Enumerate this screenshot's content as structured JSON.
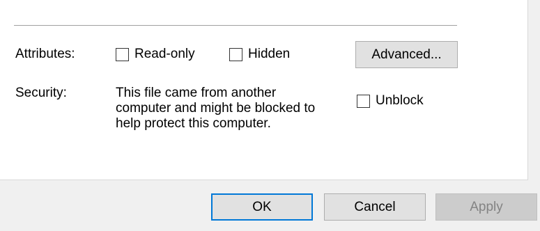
{
  "attributes": {
    "label": "Attributes:",
    "read_only": {
      "label": "Read-only",
      "checked": false
    },
    "hidden": {
      "label": "Hidden",
      "checked": false
    },
    "advanced_button": "Advanced..."
  },
  "security": {
    "label": "Security:",
    "message_lines": [
      "This file came from another",
      "computer and might be blocked to",
      "help protect this computer."
    ],
    "unblock": {
      "label": "Unblock",
      "checked": false
    }
  },
  "footer": {
    "ok": "OK",
    "cancel": "Cancel",
    "apply": "Apply"
  }
}
